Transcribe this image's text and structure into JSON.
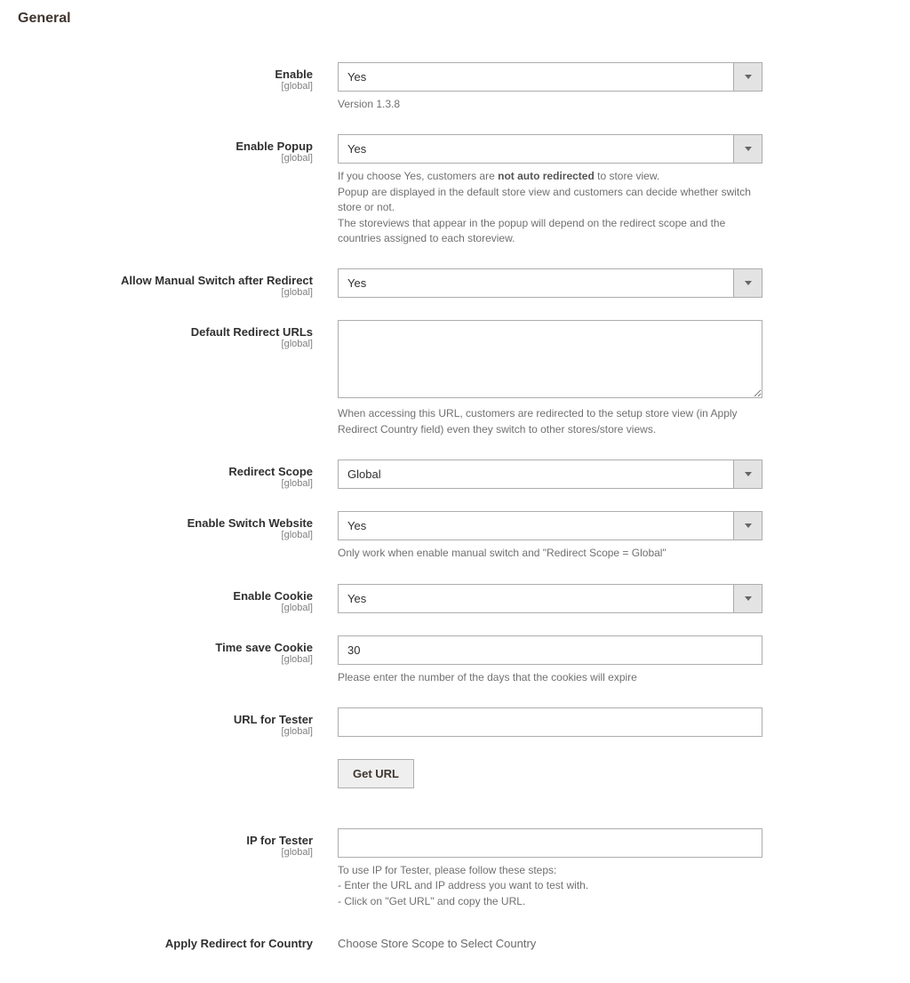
{
  "section_title": "General",
  "scope_label": "[global]",
  "fields": {
    "enable": {
      "label": "Enable",
      "value": "Yes",
      "help": "Version 1.3.8"
    },
    "enable_popup": {
      "label": "Enable Popup",
      "value": "Yes",
      "help_prefix": "If you choose Yes, customers are ",
      "help_bold": "not auto redirected",
      "help_suffix": " to store view.",
      "help_line2": "Popup are displayed in the default store view and customers can decide whether switch store or not.",
      "help_line3": "The storeviews that appear in the popup will depend on the redirect scope and the countries assigned to each storeview."
    },
    "allow_manual_switch": {
      "label": "Allow Manual Switch after Redirect",
      "value": "Yes"
    },
    "default_redirect_urls": {
      "label": "Default Redirect URLs",
      "value": "",
      "help": "When accessing this URL, customers are redirected to the setup store view (in Apply Redirect Country field) even they switch to other stores/store views."
    },
    "redirect_scope": {
      "label": "Redirect Scope",
      "value": "Global"
    },
    "enable_switch_website": {
      "label": "Enable Switch Website",
      "value": "Yes",
      "help": "Only work when enable manual switch and \"Redirect Scope = Global\""
    },
    "enable_cookie": {
      "label": "Enable Cookie",
      "value": "Yes"
    },
    "time_save_cookie": {
      "label": "Time save Cookie",
      "value": "30",
      "help": "Please enter the number of the days that the cookies will expire"
    },
    "url_for_tester": {
      "label": "URL for Tester",
      "value": ""
    },
    "get_url_button": {
      "label": "Get URL"
    },
    "ip_for_tester": {
      "label": "IP for Tester",
      "value": "",
      "help_line1": "To use IP for Tester, please follow these steps:",
      "help_line2": "- Enter the URL and IP address you want to test with.",
      "help_line3": "- Click on \"Get URL\" and copy the URL."
    },
    "apply_redirect_country": {
      "label": "Apply Redirect for Country",
      "value": "Choose Store Scope to Select Country"
    }
  }
}
